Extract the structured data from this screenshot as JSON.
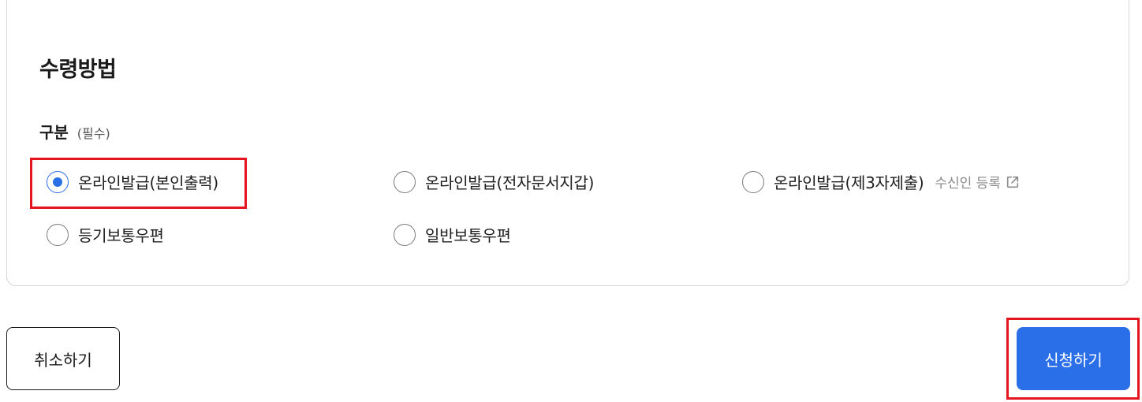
{
  "section": {
    "title": "수령방법",
    "field_label": "구분",
    "required": "(필수)"
  },
  "options": [
    {
      "label": "온라인발급(본인출력)",
      "checked": true
    },
    {
      "label": "온라인발급(전자문서지갑)",
      "checked": false
    },
    {
      "label": "온라인발급(제3자제출)",
      "checked": false
    },
    {
      "label": "등기보통우편",
      "checked": false
    },
    {
      "label": "일반보통우편",
      "checked": false
    }
  ],
  "register_link": {
    "label": "수신인 등록",
    "icon": "external-link-icon"
  },
  "buttons": {
    "cancel": "취소하기",
    "apply": "신청하기"
  },
  "colors": {
    "accent": "#2a6fe8",
    "highlight": "#e3161f",
    "border": "#d6d6d6"
  }
}
